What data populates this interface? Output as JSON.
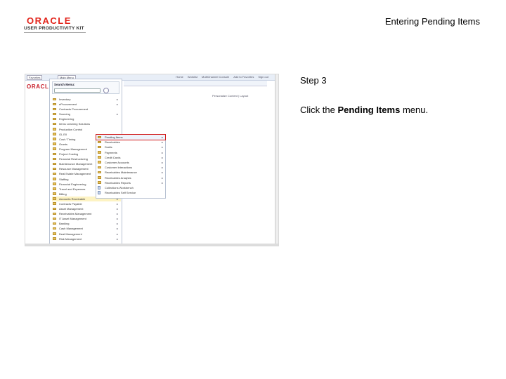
{
  "header": {
    "logo_brand": "ORACLE",
    "logo_subtitle": "USER PRODUCTIVITY KIT",
    "doc_title": "Entering Pending Items"
  },
  "step": {
    "label": "Step 3",
    "instruction_prefix": "Click the ",
    "instruction_target": "Pending Items",
    "instruction_suffix": " menu."
  },
  "screenshot": {
    "brand": "ORACLE",
    "favorites_label": "Favorites",
    "main_menu_label": "Main Menu",
    "top_links": [
      "Home",
      "Worklist",
      "MultiChannel Console",
      "Add to Favorites",
      "Sign out"
    ],
    "personalize_label": "Personalize Content | Layout",
    "search_label": "Search Menu:",
    "main_menu_items": [
      "Inventory",
      "eProcurement",
      "Contracts Procurement",
      "Sourcing",
      "Engineering",
      "Items Learning Solutions",
      "Production Control",
      "GL EII",
      "Cost / Timing",
      "Grants",
      "Program Management",
      "Project Costing",
      "Financial Restructuring",
      "Maintenance Management",
      "Resource Management",
      "Real Estate Management",
      "Staffing",
      "Financial Engineering",
      "Travel and Expenses",
      "Billing",
      "Accounts Receivable",
      "Contracts Payable",
      "Asset Management",
      "Receivables Management",
      "IT Asset Management",
      "Banking",
      "Cash Management",
      "Deal Management",
      "Risk Management"
    ],
    "submenu_items": [
      "Pending Items",
      "Receivables",
      "Drafts",
      "Payments",
      "Credit Cards",
      "Customer Accounts",
      "Customer Interactions",
      "Receivables Maintenance",
      "Receivables Analysis",
      "Receivables Reports",
      "Collections Workbench",
      "Receivables Self Service"
    ]
  }
}
